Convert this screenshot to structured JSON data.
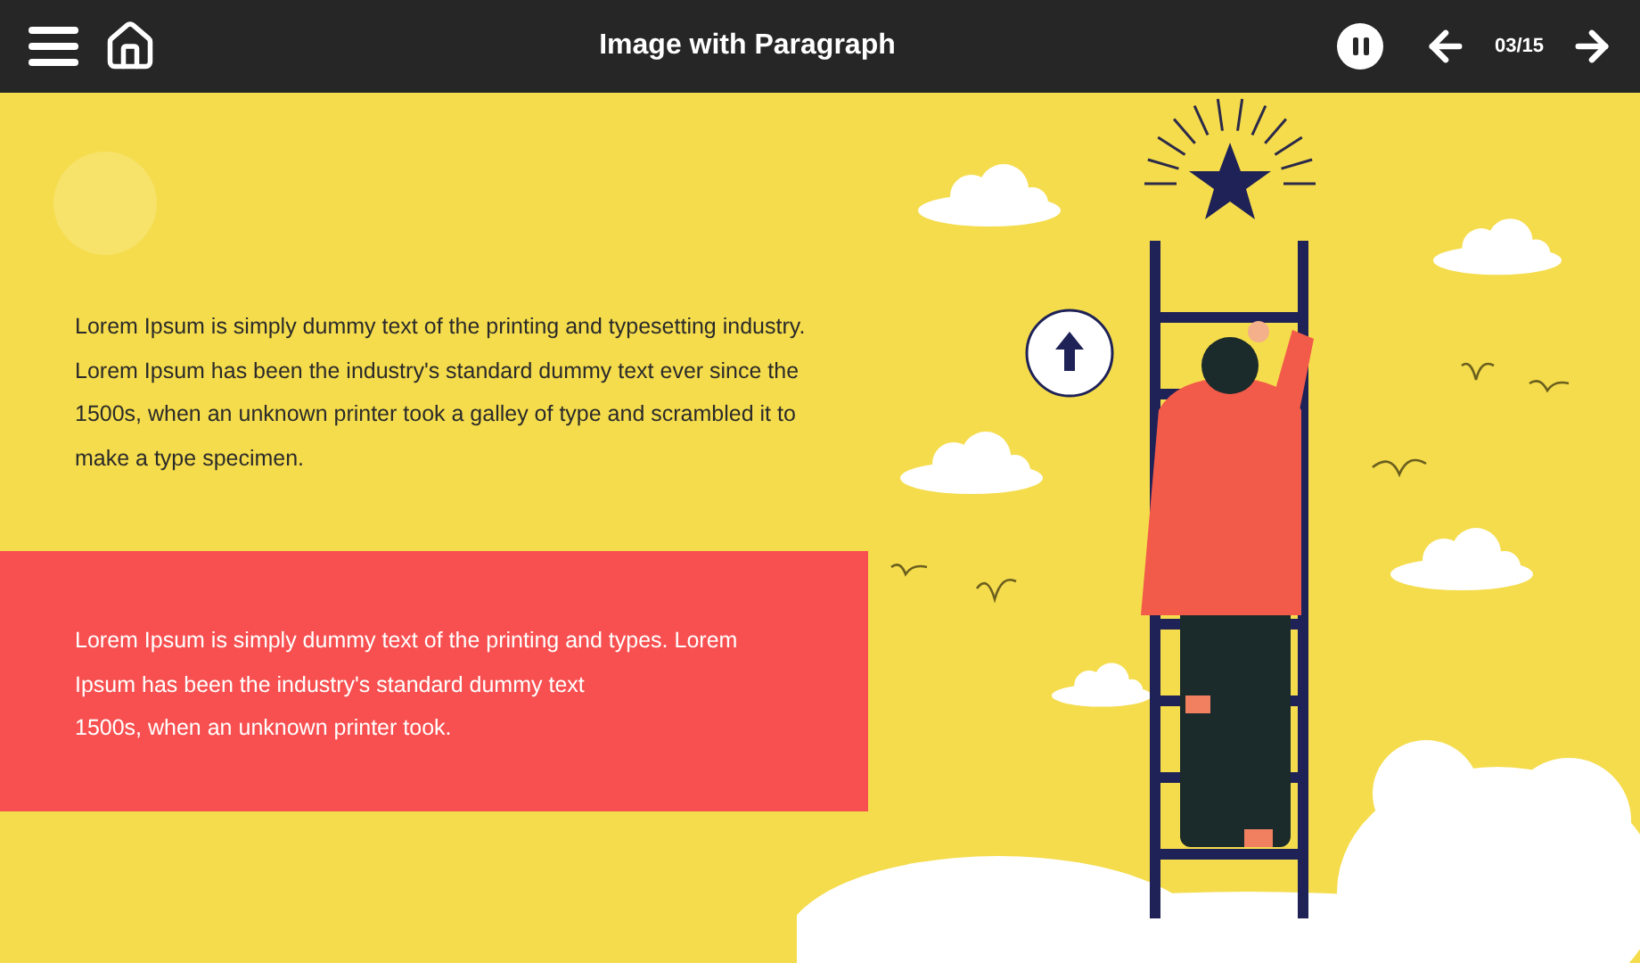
{
  "header": {
    "title": "Image with Paragraph",
    "playing": true,
    "page": "03/15"
  },
  "paragraphs": [
    {
      "kind": "plain",
      "lines": [
        "Lorem Ipsum is simply dummy text of the printing and typesetting industry.",
        "Lorem Ipsum has been the industry's standard dummy text ever since the",
        "1500s, when an unknown printer took a galley of type and scrambled it to",
        "make a type specimen."
      ]
    },
    {
      "kind": "highlight",
      "lines": [
        "Lorem Ipsum is simply dummy text of the printing and types. Lorem",
        "Ipsum has been the industry's standard dummy text",
        "1500s, when an unknown printer took."
      ]
    }
  ]
}
